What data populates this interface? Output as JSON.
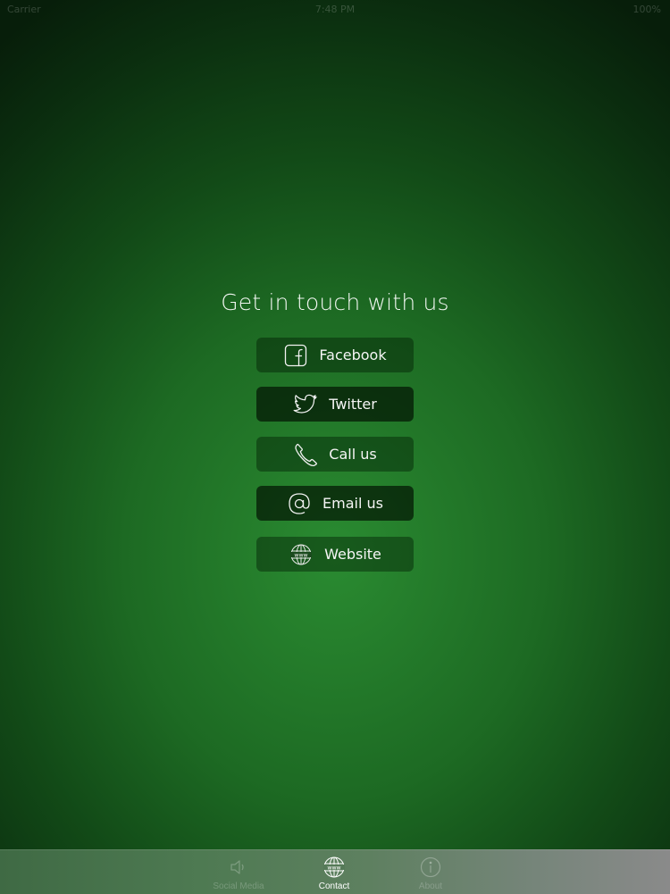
{
  "status_bar": {
    "carrier": "Carrier",
    "time": "7:48 PM",
    "battery": "100%"
  },
  "page": {
    "title": "Get in touch with us"
  },
  "buttons": [
    {
      "label": "Facebook",
      "icon": "facebook-icon"
    },
    {
      "label": "Twitter",
      "icon": "twitter-bird-icon"
    },
    {
      "label": "Call us",
      "icon": "phone-icon"
    },
    {
      "label": "Email us",
      "icon": "at-sign-icon"
    },
    {
      "label": "Website",
      "icon": "www-globe-icon"
    }
  ],
  "tab_bar": {
    "tabs": [
      {
        "label": "Social Media",
        "icon": "speaker-icon",
        "active": false
      },
      {
        "label": "Contact",
        "icon": "www-globe-icon",
        "active": true
      },
      {
        "label": "About",
        "icon": "info-icon",
        "active": false
      }
    ]
  },
  "colors": {
    "background_center": "#2a8b31",
    "background_edge": "#071e0a",
    "button_light": "#0f3612",
    "button_dark": "#0a200b",
    "text": "#ffffff"
  }
}
